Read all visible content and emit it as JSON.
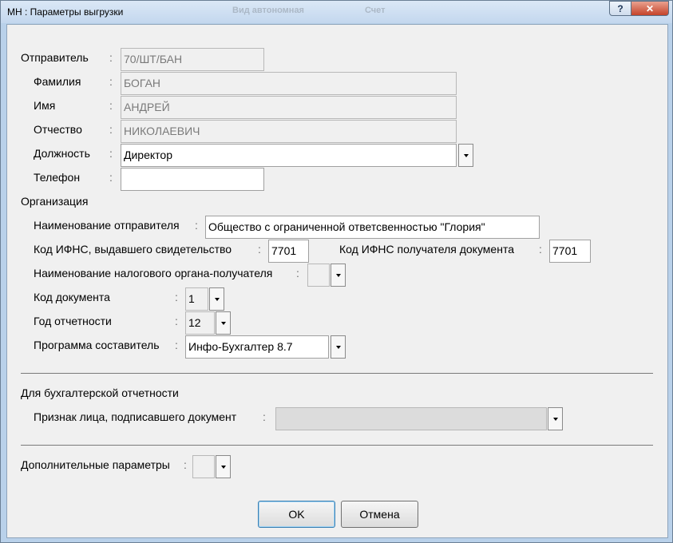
{
  "window": {
    "title": "МН : Параметры выгрузки",
    "ghost_title_1": "Вид автономная",
    "ghost_title_2": "Счет",
    "help_label": "?",
    "close_label": "✕"
  },
  "colon": ":",
  "sender": {
    "label": "Отправитель",
    "value": "70/ШТ/БАН",
    "surname_label": "Фамилия",
    "surname": "БОГАН",
    "name_label": "Имя",
    "name": "АНДРЕЙ",
    "patronymic_label": "Отчество",
    "patronymic": "НИКОЛАЕВИЧ",
    "position_label": "Должность",
    "position": "Директор",
    "phone_label": "Телефон",
    "phone": ""
  },
  "organization": {
    "section_label": "Организация",
    "sender_name_label": "Наименование отправителя",
    "sender_name": "Общество с ограниченной ответсвенностью \"Глория\"",
    "ifns_issuer_label": "Код ИФНС, выдавшего свидетельство",
    "ifns_issuer": "7701",
    "ifns_recipient_label": "Код ИФНС получателя документа",
    "ifns_recipient": "7701",
    "tax_authority_label": "Наименование налогового органа-получателя",
    "tax_authority": "",
    "doc_code_label": "Код документа",
    "doc_code": "1",
    "report_year_label": "Год отчетности",
    "report_year": "12",
    "program_label": "Программа составитель",
    "program": "Инфо-Бухгалтер 8.7"
  },
  "accounting": {
    "section_label": "Для бухгалтерской отчетности",
    "signer_label": "Признак лица, подписавшего документ",
    "signer": ""
  },
  "extra": {
    "label": "Дополнительные параметры",
    "value": ""
  },
  "buttons": {
    "ok": "OK",
    "cancel": "Отмена"
  }
}
